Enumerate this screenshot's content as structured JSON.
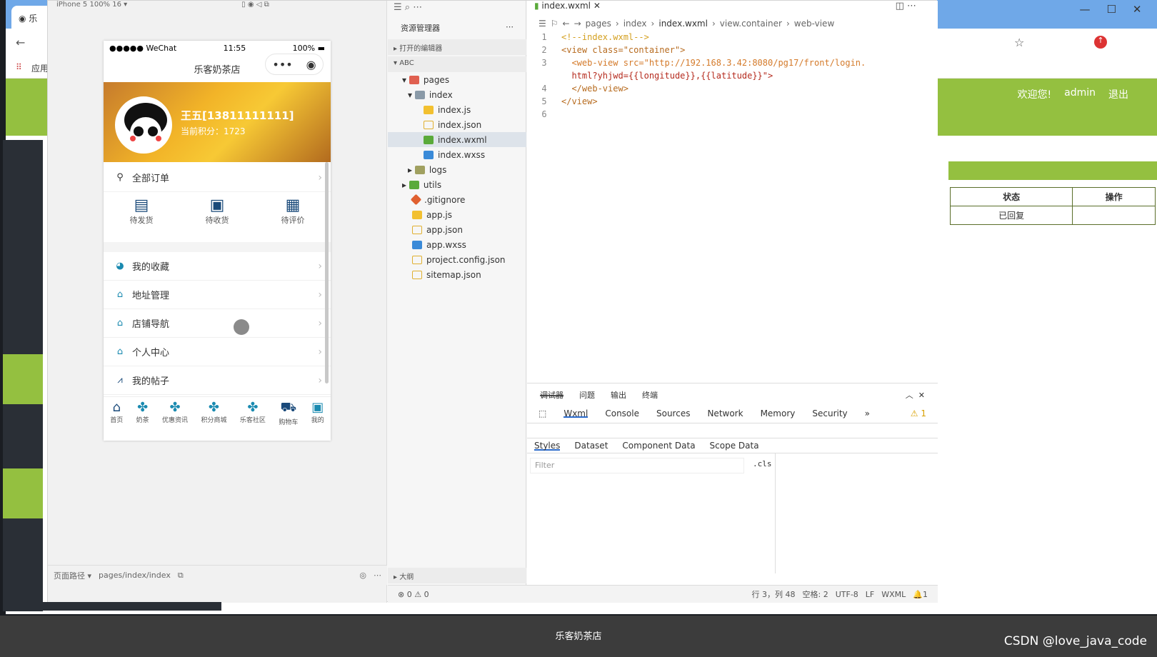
{
  "browser": {
    "tab_title": "乐",
    "bookmark_apps": "应用",
    "window_controls": [
      "—",
      "☐",
      "✕"
    ]
  },
  "site": {
    "welcome": "欢迎您!",
    "user": "admin",
    "logout": "退出",
    "table_headers": [
      "状态",
      "操作"
    ],
    "table_row": [
      "已回复",
      ""
    ],
    "footer": "乐客奶茶店",
    "watermark": "CSDN @love_java_code"
  },
  "simulator": {
    "device_label": "iPhone 5 100% 16 ▾",
    "status": {
      "carrier": "●●●●● WeChat",
      "time": "11:55",
      "battery": "100%"
    },
    "nav_title": "乐客奶茶店",
    "username": "王五[13811111111]",
    "points": "当前积分：1723",
    "all_orders": "全部订单",
    "order_states": [
      "待发货",
      "待收货",
      "待评价"
    ],
    "menu": [
      "我的收藏",
      "地址管理",
      "店铺导航",
      "个人中心",
      "我的帖子"
    ],
    "tabbar": [
      "首页",
      "奶茶",
      "优惠资讯",
      "积分商城",
      "乐客社区",
      "购物车",
      "我的"
    ],
    "page_path_label": "页面路径 ▾",
    "page_path": "pages/index/index"
  },
  "explorer": {
    "title": "资源管理器",
    "open_editors": "打开的编辑器",
    "project": "ABC",
    "files": [
      {
        "name": "pages",
        "type": "folder"
      },
      {
        "name": "index",
        "type": "folder"
      },
      {
        "name": "index.js",
        "type": "js"
      },
      {
        "name": "index.json",
        "type": "json"
      },
      {
        "name": "index.wxml",
        "type": "wxml"
      },
      {
        "name": "index.wxss",
        "type": "wxss"
      },
      {
        "name": "logs",
        "type": "folder"
      },
      {
        "name": "utils",
        "type": "folder"
      },
      {
        "name": ".gitignore",
        "type": "git"
      },
      {
        "name": "app.js",
        "type": "js"
      },
      {
        "name": "app.json",
        "type": "json"
      },
      {
        "name": "app.wxss",
        "type": "wxss"
      },
      {
        "name": "project.config.json",
        "type": "json"
      },
      {
        "name": "sitemap.json",
        "type": "json"
      }
    ],
    "outline": "大纲"
  },
  "editor": {
    "tab": "index.wxml",
    "breadcrumbs": [
      "pages",
      "index",
      "index.wxml",
      "view.container",
      "web-view"
    ],
    "lines": [
      "<!--index.wxml-->",
      "<view class=\"container\">",
      "<web-view src=\"http://192.168.3.42:8080/pg17/front/login.",
      "html?yhjwd={{longitude}},{{latitude}}\">",
      "</web-view>",
      "</view>"
    ],
    "line_numbers": [
      "1",
      "2",
      "3",
      "",
      "4",
      "5",
      "6"
    ]
  },
  "debugger": {
    "tabs": [
      "调试器",
      "问题",
      "输出",
      "终端"
    ],
    "devtabs": [
      "Wxml",
      "Console",
      "Sources",
      "Network",
      "Memory",
      "Security"
    ],
    "warn_count": "1",
    "subtabs": [
      "Styles",
      "Dataset",
      "Component Data",
      "Scope Data"
    ],
    "filter_placeholder": "Filter",
    "cls": ".cls"
  },
  "statusbar": {
    "errors": "⊗ 0 ⚠ 0",
    "position": "行 3，列 48",
    "spaces": "空格: 2",
    "encoding": "UTF-8",
    "eol": "LF",
    "lang": "WXML",
    "bell": "1"
  },
  "colors": {
    "brand_green": "#94c040",
    "dark": "#2a2f36",
    "selection": "#dde3ea"
  }
}
